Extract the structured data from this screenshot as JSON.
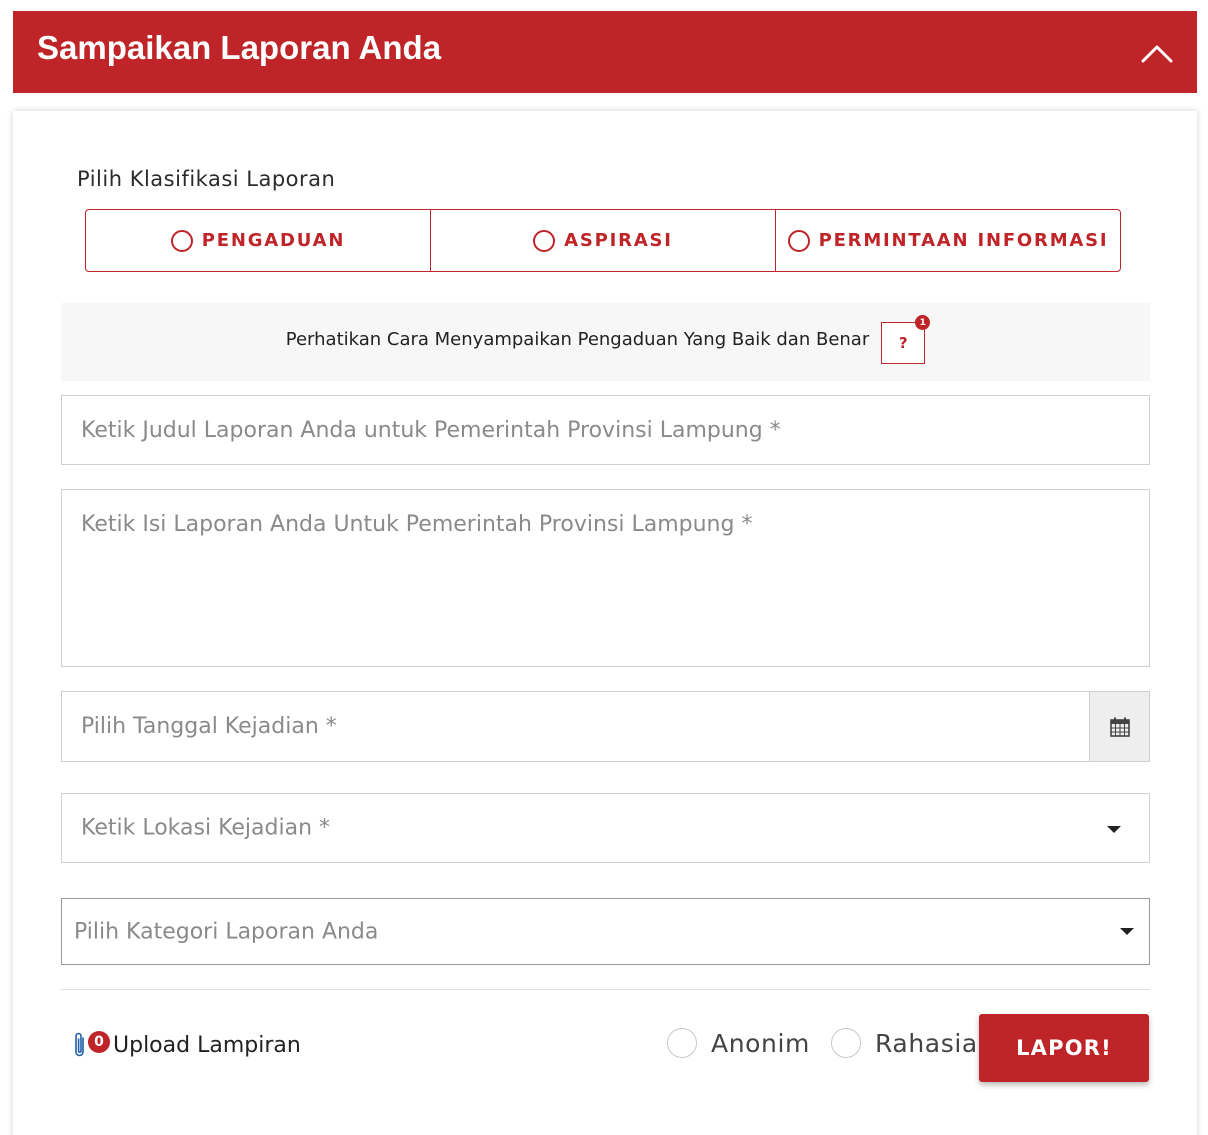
{
  "header": {
    "title": "Sampaikan Laporan Anda",
    "collapse_icon": "chevron-up-icon"
  },
  "classification": {
    "label": "Pilih Klasifikasi Laporan",
    "options": [
      {
        "label": "PENGADUAN",
        "selected": false
      },
      {
        "label": "ASPIRASI",
        "selected": false
      },
      {
        "label": "PERMINTAAN INFORMASI",
        "selected": false
      }
    ]
  },
  "notice": {
    "text": "Perhatikan Cara Menyampaikan Pengaduan Yang Baik dan Benar",
    "help_label": "?",
    "badge_count": "1"
  },
  "form": {
    "title_placeholder": "Ketik Judul Laporan Anda untuk Pemerintah Provinsi Lampung *",
    "body_placeholder": "Ketik Isi Laporan Anda Untuk Pemerintah Provinsi Lampung *",
    "date_placeholder": "Pilih Tanggal Kejadian *",
    "location_placeholder": "Ketik Lokasi Kejadian *",
    "category_placeholder": "Pilih Kategori Laporan Anda"
  },
  "footer": {
    "upload_label": "Upload Lampiran",
    "attachment_count": "0",
    "anonim_label": "Anonim",
    "rahasia_label": "Rahasia",
    "submit_label": "LAPOR!"
  },
  "colors": {
    "brand": "#bf2428",
    "border": "#cfcfcf",
    "placeholder": "#8a8a8a"
  }
}
